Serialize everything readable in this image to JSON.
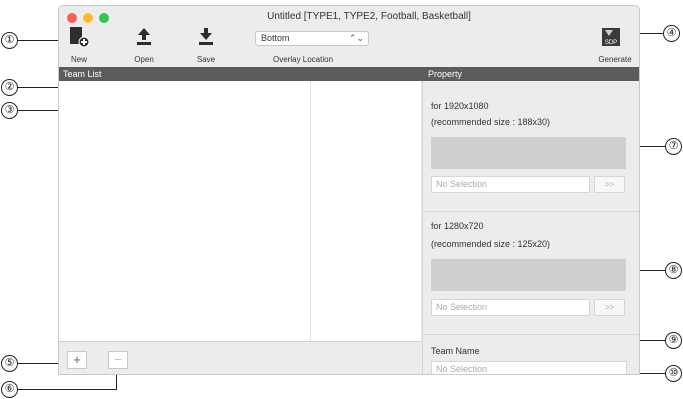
{
  "window": {
    "title": "Untitled  [TYPE1, TYPE2, Football, Basketball]",
    "controls": {
      "close": "#fc5f57",
      "minimize": "#fdbc2e",
      "zoom": "#34c84a"
    }
  },
  "toolbar": {
    "new_label": "New",
    "open_label": "Open",
    "save_label": "Save",
    "overlay_location": {
      "value": "Bottom",
      "label": "Overlay Location"
    },
    "generate_label": "Generate",
    "generate_icon_text": "SDP"
  },
  "team_list": {
    "header": "Team List",
    "add_label": "+",
    "remove_label": "−"
  },
  "property": {
    "header": "Property",
    "hd1080": {
      "title": "for 1920x1080",
      "recommend": "(recommended size : 188x30)",
      "field": "No Selection",
      "button": ">>"
    },
    "hd720": {
      "title": "for 1280x720",
      "recommend": "(recommended size : 125x20)",
      "field": "No Selection",
      "button": ">>"
    },
    "team_name": {
      "label": "Team Name",
      "field": "No Selection"
    }
  },
  "callouts": {
    "c1": "①",
    "c2": "②",
    "c3": "③",
    "c4": "④",
    "c5": "⑤",
    "c6": "⑥",
    "c7": "⑦",
    "c8": "⑧",
    "c9": "⑨",
    "c10": "⑩"
  }
}
